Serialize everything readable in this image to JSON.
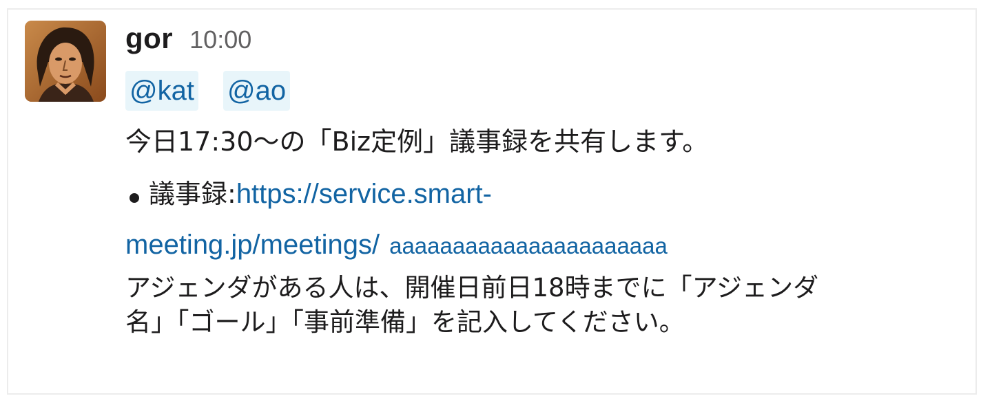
{
  "message": {
    "author": "gor",
    "time": "10:00",
    "mentions": [
      "@kat",
      "@ao"
    ],
    "line1": "今日17:30〜の「Biz定例」議事録を共有します。",
    "bullet_label": "議事録: ",
    "link_part1": "https://service.smart-",
    "link_part2": "meeting.jp/meetings/",
    "link_part3": "aaaaaaaaaaaaaaaaaaaaaa",
    "paragraph": "アジェンダがある人は、開催日前日18時までに「アジェンダ名」「ゴール」「事前準備」を記入してください。"
  },
  "colors": {
    "link": "#1264a3",
    "mention_bg": "#e8f5fa",
    "text": "#1d1c1d",
    "timestamp": "#616061"
  }
}
